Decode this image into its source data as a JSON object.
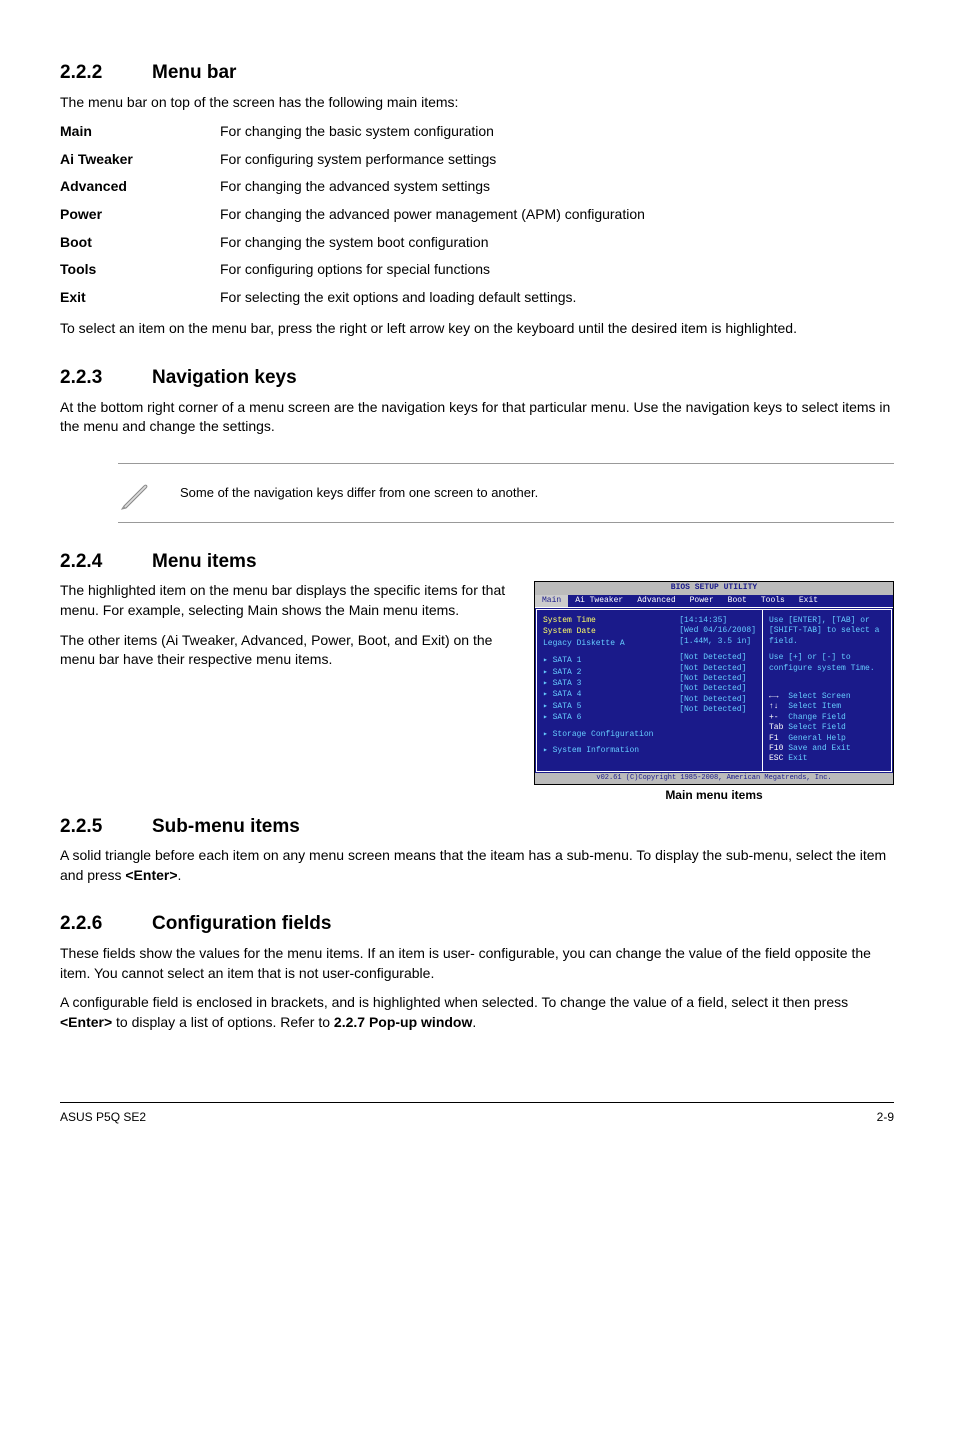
{
  "sections": {
    "menubar": {
      "num": "2.2.2",
      "title": "Menu bar",
      "intro": "The menu bar on top of the screen has the following main items:",
      "defs": [
        {
          "term": "Main",
          "desc": "For changing the basic system configuration"
        },
        {
          "term": "Ai Tweaker",
          "desc": "For configuring system performance settings"
        },
        {
          "term": "Advanced",
          "desc": "For changing the advanced system settings"
        },
        {
          "term": "Power",
          "desc": "For changing the advanced power management (APM) configuration"
        },
        {
          "term": "Boot",
          "desc": "For changing the system boot configuration"
        },
        {
          "term": "Tools",
          "desc": "For configuring options for special functions"
        },
        {
          "term": "Exit",
          "desc": "For selecting the exit options and loading default settings."
        }
      ],
      "outro": "To select an item on the menu bar, press the right or left arrow key on the keyboard until the desired item is highlighted."
    },
    "navkeys": {
      "num": "2.2.3",
      "title": "Navigation keys",
      "p": "At the bottom right corner of a menu screen are the navigation keys for that particular menu. Use the navigation keys to select items in the menu and change the settings.",
      "note": "Some of the navigation keys differ from one screen to another."
    },
    "menuitems": {
      "num": "2.2.4",
      "title": "Menu items",
      "p1": "The highlighted item on the menu bar displays the specific items for that menu. For example, selecting Main shows the Main menu items.",
      "p2": "The other items (Ai Tweaker, Advanced, Power, Boot, and Exit) on the menu bar have their respective menu items.",
      "caption": "Main menu items"
    },
    "submenu": {
      "num": "2.2.5",
      "title": "Sub-menu items",
      "p": "A solid triangle before each item on any menu screen means that the iteam has a sub-menu. To display the sub-menu, select the item and press ",
      "key": "<Enter>",
      "p_end": "."
    },
    "config": {
      "num": "2.2.6",
      "title": "Configuration fields",
      "p1": "These fields show the values for the menu items. If an item is user- configurable, you can change the value of the field opposite the item. You cannot select an item that is not user-configurable.",
      "p2a": "A configurable field is enclosed in brackets, and is highlighted when selected. To change the value of a field, select it then press ",
      "p2key": "<Enter>",
      "p2b": " to display a list of options. Refer to ",
      "p2ref": "2.2.7 Pop-up window",
      "p2c": "."
    }
  },
  "bios": {
    "title": "BIOS SETUP UTILITY",
    "tabs": [
      "Main",
      "Ai Tweaker",
      "Advanced",
      "Power",
      "Boot",
      "Tools",
      "Exit"
    ],
    "left": {
      "systime": {
        "name": "System Time",
        "val": "[14:14:35]"
      },
      "sysdate": {
        "name": "System Date",
        "val": "[Wed 04/16/2008]"
      },
      "legacy": {
        "name": "Legacy Diskette A",
        "val": "[1.44M, 3.5 in]"
      },
      "sata": [
        {
          "n": "SATA 1",
          "v": "[Not Detected]"
        },
        {
          "n": "SATA 2",
          "v": "[Not Detected]"
        },
        {
          "n": "SATA 3",
          "v": "[Not Detected]"
        },
        {
          "n": "SATA 4",
          "v": "[Not Detected]"
        },
        {
          "n": "SATA 5",
          "v": "[Not Detected]"
        },
        {
          "n": "SATA 6",
          "v": "[Not Detected]"
        }
      ],
      "storage": "Storage Configuration",
      "sysinfo": "System Information"
    },
    "right": {
      "help1": "Use [ENTER], [TAB] or [SHIFT-TAB] to select a field.",
      "help2": "Use [+] or [-] to configure system Time.",
      "keys": [
        {
          "k": "←→",
          "d": "Select Screen"
        },
        {
          "k": "↑↓",
          "d": "Select Item"
        },
        {
          "k": "+-",
          "d": "Change Field"
        },
        {
          "k": "Tab",
          "d": "Select Field"
        },
        {
          "k": "F1",
          "d": "General Help"
        },
        {
          "k": "F10",
          "d": "Save and Exit"
        },
        {
          "k": "ESC",
          "d": "Exit"
        }
      ]
    },
    "copy": "v02.61 (C)Copyright 1985-2008, American Megatrends, Inc."
  },
  "footer": {
    "left": "ASUS P5Q SE2",
    "right": "2-9"
  }
}
